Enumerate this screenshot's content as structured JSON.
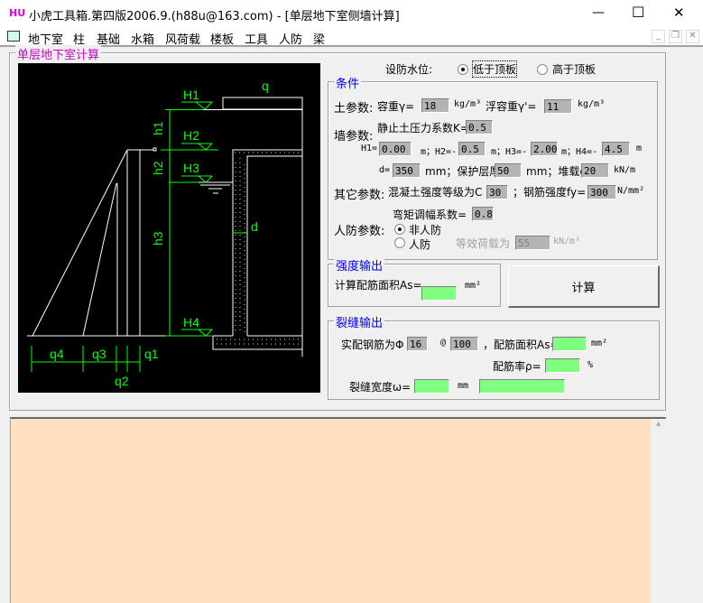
{
  "window": {
    "logo": "HU",
    "title": "小虎工具箱.第四版2006.9.(h88u@163.com) - [单层地下室侧墙计算]",
    "min": "—",
    "max": "☐",
    "close": "✕",
    "child_min": "_",
    "child_restore": "❐",
    "child_close": "✕"
  },
  "menu": [
    "地下室",
    "柱",
    "基础",
    "水箱",
    "风荷载",
    "楼板",
    "工具",
    "人防",
    "梁"
  ],
  "main_group": "单层地下室计算",
  "drawing": {
    "H1": "H1",
    "H2": "H2",
    "H3": "H3",
    "H4": "H4",
    "h1": "h1",
    "h2": "h2",
    "h3": "h3",
    "q": "q",
    "d": "d",
    "q1": "q1",
    "q2": "q2",
    "q3": "q3",
    "q4": "q4"
  },
  "water_level": {
    "label": "设防水位:",
    "opt1": "低于顶板",
    "opt2": "高于顶板",
    "selected": "低于顶板"
  },
  "conditions": {
    "title": "条件",
    "soil_label": "土参数:",
    "gamma_label": "容重γ=",
    "gamma": "18",
    "unit1": "kg/m³",
    "gamma2_label": "浮容重γ'=",
    "gamma2": "11",
    "unit2": "kg/m³",
    "wall_label": "墙参数:",
    "k_label": "静止土压力系数K=",
    "k": "0.5",
    "h1_label": "H1=",
    "h1": "0.00",
    "h2_label": "m；H2=-",
    "h2": "0.5",
    "h3_label": "m；H3=-",
    "h3": "2.00",
    "h4_label": "m；H4=-",
    "h4": "4.5",
    "m": "m",
    "d_label": "d=",
    "d": "350",
    "cover_label": "mm；保护层厚",
    "cover": "50",
    "q_label": "mm；堆载q=",
    "q": "20",
    "q_unit": "kN/m",
    "other_label": "其它参数:",
    "concrete_label": "混凝土强度等级为C",
    "concrete": "30",
    "fy_label": "；钢筋强度fy=",
    "fy": "300",
    "fy_unit": "N/mm²",
    "moment_label": "弯矩调幅系数=",
    "moment": "0.8",
    "civil_label": "人防参数:",
    "civil_opt1": "非人防",
    "civil_opt2": "人防",
    "equiv_label": "等效荷载为",
    "equiv": "55",
    "equiv_unit": "kN/m²"
  },
  "strength": {
    "title": "强度输出",
    "as_label": "计算配筋面积As=",
    "as": "",
    "unit": "mm²"
  },
  "calc_button": "计算",
  "crack": {
    "title": "裂缝输出",
    "bar_label": "实配钢筋为Φ",
    "dia": "16",
    "at": "@",
    "spacing": "100",
    "area_label": "，配筋面积As=",
    "area": "",
    "area_unit": "mm²",
    "ratio_label": "配筋率ρ=",
    "ratio": "",
    "pct": "%",
    "width_label": "裂缝宽度ω=",
    "width": "",
    "mm": "mm",
    "result": ""
  },
  "colors": {
    "magenta": "#cc00cc",
    "blue": "#0000ff",
    "green": "#00ff00",
    "peach": "#ffe0c0"
  }
}
